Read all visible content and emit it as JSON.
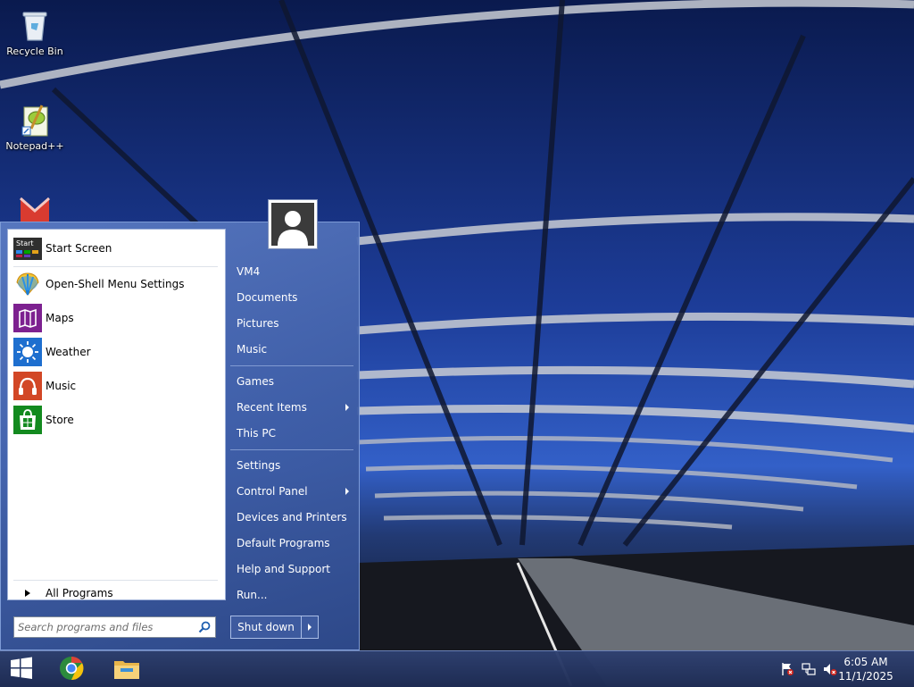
{
  "desktop": {
    "icons": [
      {
        "label": "Recycle Bin",
        "icon": "recycle-bin-icon"
      },
      {
        "label": "Notepad++",
        "icon": "notepad-plus-plus-icon"
      },
      {
        "label": "",
        "icon": "gmail-icon"
      }
    ]
  },
  "start_menu": {
    "programs": [
      {
        "label": "Start Screen",
        "icon": "start-screen-icon",
        "icon_text": "Start"
      },
      {
        "label": "Open-Shell Menu Settings",
        "icon": "shell-icon"
      },
      {
        "label": "Maps",
        "icon": "maps-icon"
      },
      {
        "label": "Weather",
        "icon": "weather-icon"
      },
      {
        "label": "Music",
        "icon": "headphones-icon"
      },
      {
        "label": "Store",
        "icon": "store-icon"
      }
    ],
    "all_programs_label": "All Programs",
    "search": {
      "placeholder": "Search programs and files",
      "value": ""
    },
    "user": {
      "avatar": "user-avatar-icon"
    },
    "right_items": [
      {
        "label": "VM4"
      },
      {
        "label": "Documents"
      },
      {
        "label": "Pictures"
      },
      {
        "label": "Music"
      },
      {
        "label": "Games"
      },
      {
        "label": "Recent Items"
      },
      {
        "label": "This PC"
      },
      {
        "label": "Settings"
      },
      {
        "label": "Control Panel"
      },
      {
        "label": "Devices and Printers"
      },
      {
        "label": "Default Programs"
      },
      {
        "label": "Help and Support"
      },
      {
        "label": "Run..."
      }
    ],
    "shutdown_label": "Shut down"
  },
  "taskbar": {
    "buttons": [
      {
        "icon": "windows-start-icon"
      },
      {
        "icon": "chrome-icon"
      },
      {
        "icon": "file-explorer-icon"
      }
    ],
    "tray": [
      {
        "icon": "action-center-flag-icon"
      },
      {
        "icon": "network-icon"
      },
      {
        "icon": "volume-muted-icon"
      }
    ],
    "clock": {
      "time": "6:05 AM",
      "date": "11/1/2025"
    }
  },
  "colors": {
    "menu_blue": "#4a6db8",
    "taskbar": "#24345f",
    "maps_tile": "#7d2190",
    "weather_tile": "#1e6fcf",
    "music_tile": "#d24726",
    "store_tile": "#138a1f"
  }
}
